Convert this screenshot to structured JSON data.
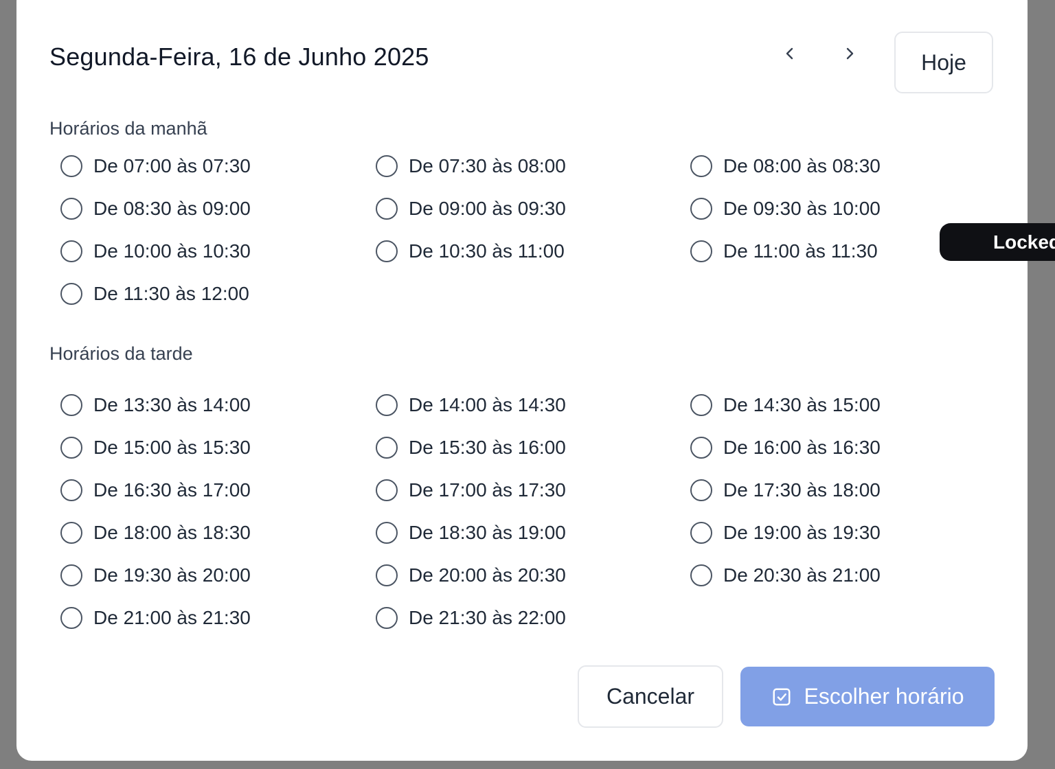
{
  "header": {
    "title": "Segunda-Feira, 16 de Junho 2025",
    "prev_icon": "chevron-left-icon",
    "next_icon": "chevron-right-icon",
    "today_label": "Hoje"
  },
  "morning": {
    "label": "Horários da manhã",
    "slots": [
      "De 07:00 às 07:30",
      "De 07:30 às 08:00",
      "De 08:00 às 08:30",
      "De 08:30 às 09:00",
      "De 09:00 às 09:30",
      "De 09:30 às 10:00",
      "De 10:00 às 10:30",
      "De 10:30 às 11:00",
      "De 11:00 às 11:30",
      "De 11:30 às 12:00"
    ]
  },
  "afternoon": {
    "label": "Horários da tarde",
    "slots": [
      "De 13:30 às 14:00",
      "De 14:00 às 14:30",
      "De 14:30 às 15:00",
      "De 15:00 às 15:30",
      "De 15:30 às 16:00",
      "De 16:00 às 16:30",
      "De 16:30 às 17:00",
      "De 17:00 às 17:30",
      "De 17:30 às 18:00",
      "De 18:00 às 18:30",
      "De 18:30 às 19:00",
      "De 19:00 às 19:30",
      "De 19:30 às 20:00",
      "De 20:00 às 20:30",
      "De 20:30 às 21:00",
      "De 21:00 às 21:30",
      "De 21:30 às 22:00"
    ]
  },
  "footer": {
    "cancel_label": "Cancelar",
    "confirm_label": "Escolher horário",
    "confirm_icon": "check-square-icon"
  },
  "locked_tab": {
    "label": "Locked"
  },
  "colors": {
    "overlay": "#7f7f7f",
    "modal_bg": "#ffffff",
    "primary_disabled": "#81a0e6",
    "text": "#1f2937",
    "border": "#e5e7eb"
  }
}
